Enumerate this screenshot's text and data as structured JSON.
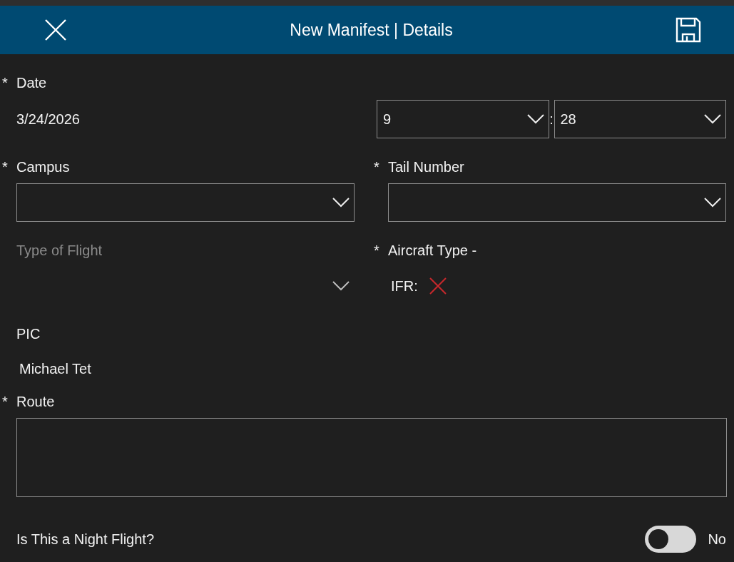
{
  "header": {
    "title": "New Manifest | Details"
  },
  "date": {
    "label": "Date",
    "required_mark": "*",
    "value": "3/24/2026",
    "hour": "9",
    "separator": ":",
    "minute": "28"
  },
  "campus": {
    "label": "Campus",
    "required_mark": "*"
  },
  "tail_number": {
    "label": "Tail Number",
    "required_mark": "*"
  },
  "type_of_flight": {
    "label": "Type of Flight",
    "disabled": true
  },
  "aircraft_type": {
    "label": "Aircraft Type -",
    "required_mark": "*",
    "ifr_label": "IFR:",
    "ifr": false
  },
  "pic": {
    "label": "PIC",
    "value": "Michael Tet"
  },
  "route": {
    "label": "Route",
    "required_mark": "*"
  },
  "night_flight": {
    "label": "Is This a Night Flight?",
    "on": false,
    "value": "No"
  }
}
